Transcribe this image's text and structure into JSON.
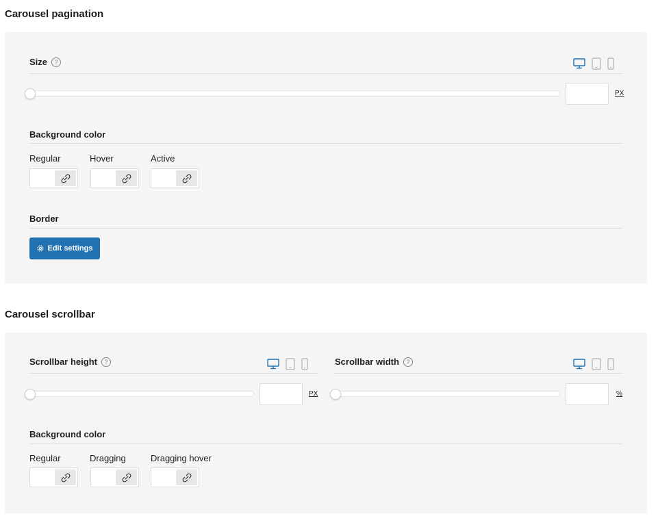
{
  "pagination": {
    "title": "Carousel pagination",
    "size": {
      "label": "Size",
      "help": "?",
      "unit": "PX",
      "value": "",
      "slider_level": 0
    },
    "bg": {
      "label": "Background color",
      "states": [
        {
          "label": "Regular"
        },
        {
          "label": "Hover"
        },
        {
          "label": "Active"
        }
      ]
    },
    "border": {
      "label": "Border",
      "button": "Edit settings"
    }
  },
  "scrollbar": {
    "title": "Carousel scrollbar",
    "height": {
      "label": "Scrollbar height",
      "help": "?",
      "unit": "PX",
      "value": "",
      "slider_level": 0
    },
    "width": {
      "label": "Scrollbar width",
      "help": "?",
      "unit": "%",
      "value": "",
      "slider_level": 0
    },
    "bg": {
      "label": "Background color",
      "states": [
        {
          "label": "Regular"
        },
        {
          "label": "Dragging"
        },
        {
          "label": "Dragging hover"
        }
      ]
    }
  },
  "colors": {
    "accent": "#2271b1",
    "panel": "#f5f5f5",
    "active_device": "#2271b1",
    "inactive_device": "#b0b0b0"
  },
  "icons": {
    "desktop": "desktop-icon",
    "tablet": "tablet-icon",
    "mobile": "mobile-icon",
    "link": "link-icon",
    "gear": "gear-icon",
    "help": "help-icon"
  }
}
